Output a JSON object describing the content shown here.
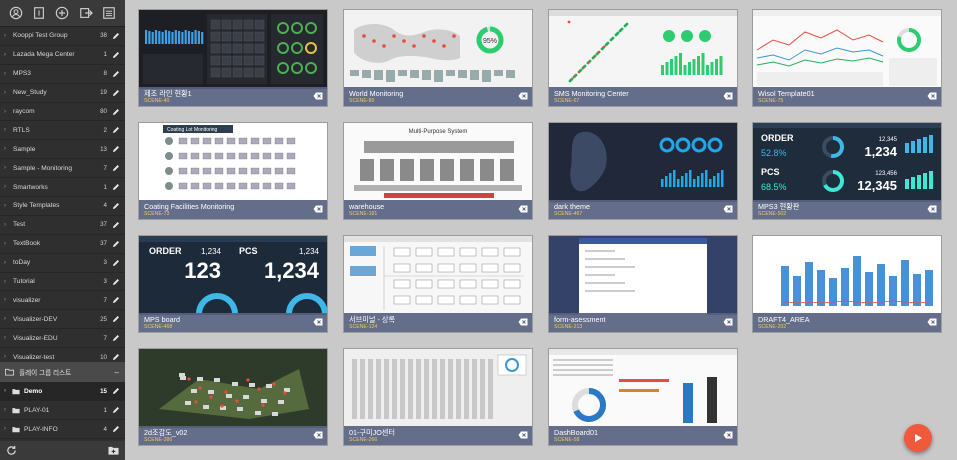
{
  "topbar": {
    "icons": [
      "user-circle-icon",
      "document-icon",
      "plus-circle-icon",
      "logout-icon",
      "list-icon"
    ]
  },
  "groups": [
    {
      "label": "Kooppi Test Group",
      "count": "38"
    },
    {
      "label": "Lazada Mega Center",
      "count": "1"
    },
    {
      "label": "MPS3",
      "count": "8"
    },
    {
      "label": "New_Study",
      "count": "19"
    },
    {
      "label": "raycom",
      "count": "80"
    },
    {
      "label": "RTLS",
      "count": "2"
    },
    {
      "label": "Sample",
      "count": "13"
    },
    {
      "label": "Sample - Monitoring",
      "count": "7"
    },
    {
      "label": "Smartworks",
      "count": "1"
    },
    {
      "label": "Style Templates",
      "count": "4"
    },
    {
      "label": "Test",
      "count": "37"
    },
    {
      "label": "TextBook",
      "count": "37"
    },
    {
      "label": "toDay",
      "count": "3"
    },
    {
      "label": "Tutorial",
      "count": "3"
    },
    {
      "label": "visualizer",
      "count": "7"
    },
    {
      "label": "Visualizer-DEV",
      "count": "25"
    },
    {
      "label": "Visualizer-EDU",
      "count": "7"
    },
    {
      "label": "Visualizer-test",
      "count": "10"
    }
  ],
  "play_section": {
    "title": "플레이 그룹 리스트",
    "items": [
      {
        "label": "Demo",
        "count": "15"
      },
      {
        "label": "PLAY-01",
        "count": "1"
      },
      {
        "label": "PLAY-INFO",
        "count": "4"
      }
    ]
  },
  "colors": {
    "sidebar_bg": "#2f2f2f",
    "caption_bg": "#58628a",
    "scene_text": "#f0c860",
    "play_button": "#ef5a3c",
    "main_bg": "#c9c9c9"
  },
  "cards": [
    {
      "name": "제조 라인 현황1",
      "scene": "SCENE-40",
      "theme": "dark-dashboard"
    },
    {
      "name": "World Monitoring",
      "scene": "SCENE-80",
      "theme": "world-map"
    },
    {
      "name": "SMS Monitoring Center",
      "scene": "SCENE-67",
      "theme": "korea-map-light"
    },
    {
      "name": "Wisol Template01",
      "scene": "SCENE-75",
      "theme": "line-charts"
    },
    {
      "name": "Coating Facilities Monitoring",
      "scene": "SCENE-73",
      "theme": "coating"
    },
    {
      "name": "warehouse",
      "scene": "SCENE-181",
      "theme": "warehouse"
    },
    {
      "name": "dark theme",
      "scene": "SCENE-467",
      "theme": "korea-map-dark"
    },
    {
      "name": "MPS3 현황판",
      "scene": "SCENE-502",
      "theme": "mps3-kpi"
    },
    {
      "name": "MPS board",
      "scene": "SCENE-468",
      "theme": "mps-board"
    },
    {
      "name": "서브미널 - 상록",
      "scene": "SCENE-124",
      "theme": "floorplan"
    },
    {
      "name": "form-asessment",
      "scene": "SCENE-213",
      "theme": "form"
    },
    {
      "name": "DRAFT4_AREA",
      "scene": "SCENE-202",
      "theme": "bar-chart"
    },
    {
      "name": "2d조감도_v02",
      "scene": "SCENE-386",
      "theme": "aerial"
    },
    {
      "name": "01-구미JO센터",
      "scene": "SCENE-266",
      "theme": "warehouse-plan"
    },
    {
      "name": "DashBoard01",
      "scene": "SCENE-58",
      "theme": "donut-dashboard"
    }
  ],
  "thumb_text": {
    "mps3_order_label": "ORDER",
    "mps3_order_pct": "52.8%",
    "mps3_order_value": "1,234",
    "mps3_order_small": "12,345",
    "mps3_pcs_label": "PCS",
    "mps3_pcs_pct": "68.5%",
    "mps3_pcs_value": "12,345",
    "mps3_pcs_small": "123,456",
    "mps_order_label": "ORDER",
    "mps_order_small": "1,234",
    "mps_order_value": "123",
    "mps_pcs_label": "PCS",
    "mps_pcs_small": "1,234",
    "mps_pcs_value": "1,234",
    "world_pct": "95%",
    "warehouse_title": "Multi-Purpose System",
    "coating_title": "Coating Lot Monitoring"
  }
}
